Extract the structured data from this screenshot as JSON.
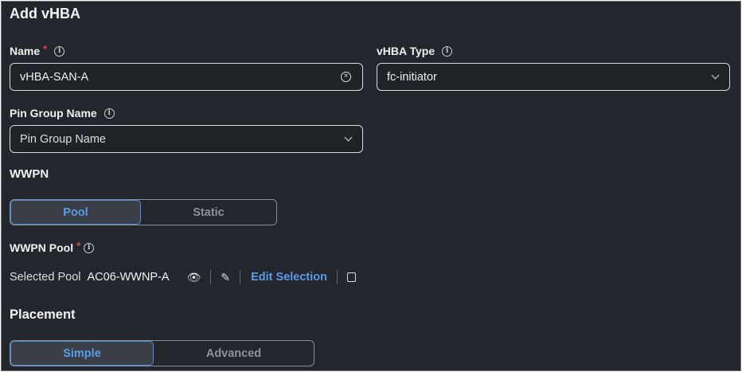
{
  "title": "Add vHBA",
  "name": {
    "label": "Name",
    "required": "*",
    "value": "vHBA-SAN-A"
  },
  "vhba_type": {
    "label": "vHBA Type",
    "value": "fc-initiator"
  },
  "pin_group": {
    "label": "Pin Group Name",
    "placeholder": "Pin Group Name"
  },
  "wwpn": {
    "heading": "WWPN",
    "options": [
      "Pool",
      "Static"
    ],
    "selected": "Pool"
  },
  "wwpn_pool": {
    "label": "WWPN Pool",
    "required": "*",
    "selected_label": "Selected Pool",
    "selected_value": "AC06-WWNP-A",
    "edit_label": "Edit Selection"
  },
  "placement": {
    "heading": "Placement",
    "options": [
      "Simple",
      "Advanced"
    ],
    "selected": "Simple"
  },
  "colors": {
    "background": "#23262c",
    "accent": "#5b9be8",
    "required": "#e0434f"
  }
}
